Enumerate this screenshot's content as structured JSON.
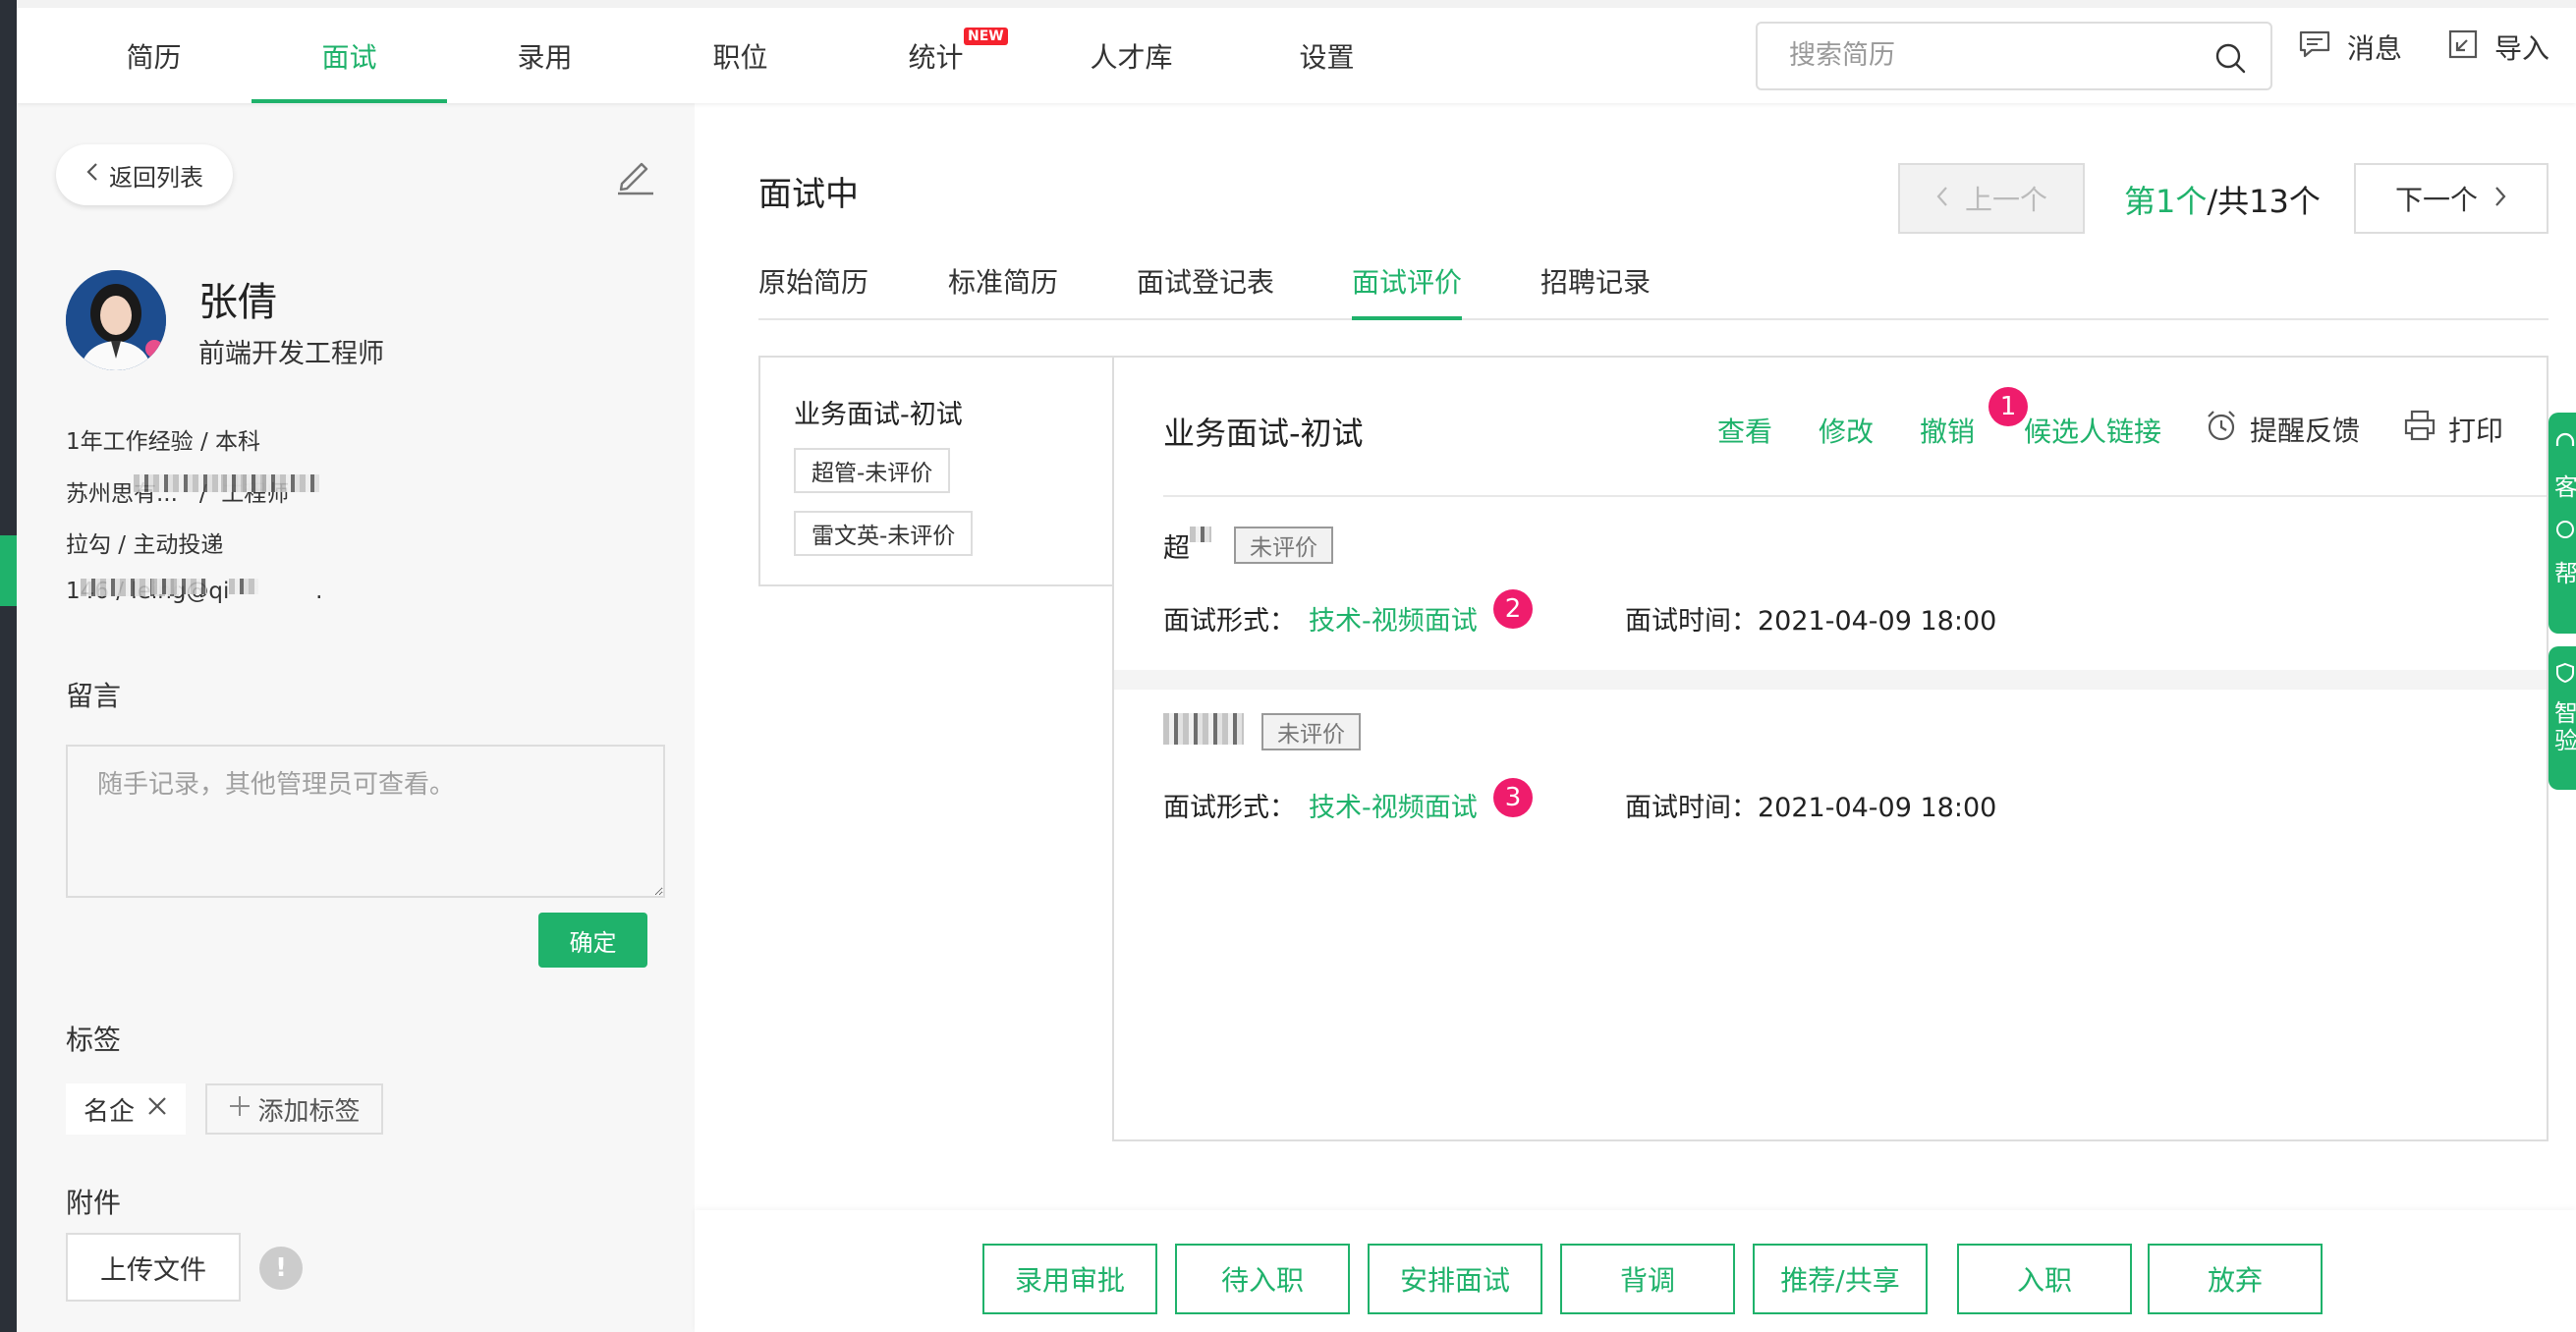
{
  "nav": {
    "tabs": [
      {
        "label": "简历"
      },
      {
        "label": "面试",
        "active": true
      },
      {
        "label": "录用"
      },
      {
        "label": "职位"
      },
      {
        "label": "统计",
        "badge": "NEW"
      },
      {
        "label": "人才库"
      },
      {
        "label": "设置"
      }
    ],
    "search_placeholder": "搜索简历",
    "messages_label": "消息",
    "import_label": "导入"
  },
  "sidebar": {
    "back_label": "返回列表",
    "candidate": {
      "name": "张倩",
      "title": "前端开发工程师",
      "exp_edu": "1年工作经验 / 本科",
      "company_prefix": "苏州思",
      "company_suffix": "有...",
      "job_sep": "/",
      "job_suffix": "工程师",
      "source": "拉勾 / 主动投递",
      "phone_prefix": "1",
      "phone_suffix": "46",
      "contact_sep": "/",
      "email_prefix": "le",
      "email_mid": "ing@qi",
      "email_end": "."
    },
    "note": {
      "title": "留言",
      "placeholder": "随手记录，其他管理员可查看。",
      "confirm_label": "确定"
    },
    "tags": {
      "title": "标签",
      "items": [
        "名企"
      ],
      "add_label": "添加标签"
    },
    "attachments": {
      "title": "附件",
      "upload_label": "上传文件",
      "info_glyph": "!"
    }
  },
  "main": {
    "status_title": "面试中",
    "prev_label": "上一个",
    "next_label": "下一个",
    "pager": {
      "prefix": "第",
      "current": "1个",
      "total": "/共13个"
    },
    "tabs": [
      {
        "label": "原始简历"
      },
      {
        "label": "标准简历"
      },
      {
        "label": "面试登记表"
      },
      {
        "label": "面试评价",
        "active": true
      },
      {
        "label": "招聘记录"
      }
    ],
    "eval_list": {
      "title": "业务面试-初试",
      "chips": [
        "超管-未评价",
        "雷文英-未评价"
      ]
    },
    "detail": {
      "title": "业务面试-初试",
      "actions": {
        "view": "查看",
        "edit": "修改",
        "revoke": "撤销",
        "candidate_link": "候选人链接",
        "remind": "提醒反馈",
        "print": "打印"
      },
      "badges": [
        "1",
        "2",
        "3"
      ],
      "form_label": "面试形式：",
      "time_label": "面试时间：",
      "interviewers": [
        {
          "name": "超",
          "status": "未评价",
          "form": "技术-视频面试",
          "time": "2021-04-09 18:00"
        },
        {
          "name": "",
          "status": "未评价",
          "form": "技术-视频面试",
          "time": "2021-04-09 18:00"
        }
      ]
    }
  },
  "bottom_actions": [
    "录用审批",
    "待入职",
    "安排面试",
    "背调",
    "推荐/共享",
    "入职",
    "放弃"
  ],
  "float_tabs": [
    {
      "label": "客"
    },
    {
      "label": "帮"
    },
    {
      "label": "智\n验"
    }
  ],
  "colors": {
    "accent": "#1fb26b",
    "badge": "#ef1c6c",
    "new_badge": "#f5222d"
  }
}
